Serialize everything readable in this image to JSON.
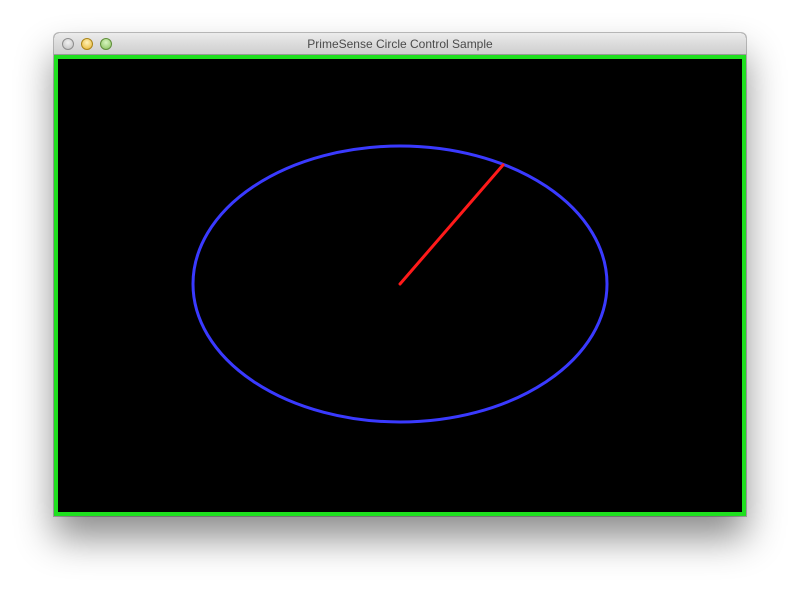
{
  "window": {
    "title": "PrimeSense Circle Control Sample",
    "buttons": [
      "close",
      "minimize",
      "zoom"
    ]
  },
  "canvas": {
    "background_color": "#000000",
    "border_color": "#1fe01f",
    "circle_color": "#3a3aff",
    "indicator_color": "#ff1a1a"
  }
}
